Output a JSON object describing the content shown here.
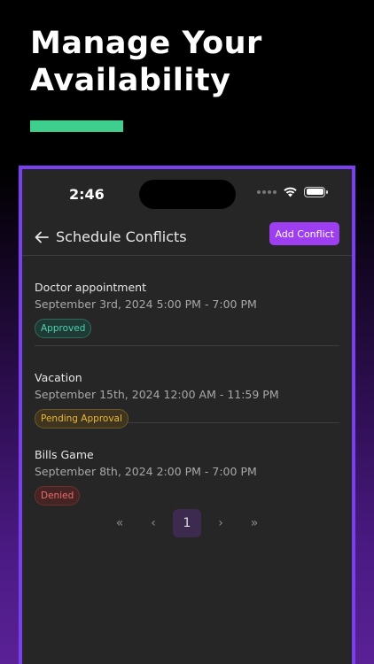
{
  "headline": {
    "line1": "Manage Your",
    "line2": "Availability"
  },
  "colors": {
    "accent_bar": "#3ecf8e",
    "phone_border": "#7b3ff2",
    "add_button": "#9d3ef0",
    "approved": "#4fd1b0",
    "pending": "#e7b93a",
    "denied": "#f06a6a"
  },
  "status_bar": {
    "time": "2:46"
  },
  "header": {
    "title": "Schedule Conflicts",
    "add_button_label": "Add Conflict"
  },
  "conflicts": [
    {
      "title": "Doctor appointment",
      "date": "September 3rd, 2024 5:00 PM - 7:00 PM",
      "status": "Approved"
    },
    {
      "title": "Vacation",
      "date": "September 15th, 2024 12:00 AM - 11:59 PM",
      "status": "Pending Approval"
    },
    {
      "title": "Bills Game",
      "date": "September 8th, 2024 2:00 PM - 7:00 PM",
      "status": "Denied"
    }
  ],
  "pagination": {
    "first": "«",
    "prev": "‹",
    "current": "1",
    "next": "›",
    "last": "»"
  }
}
